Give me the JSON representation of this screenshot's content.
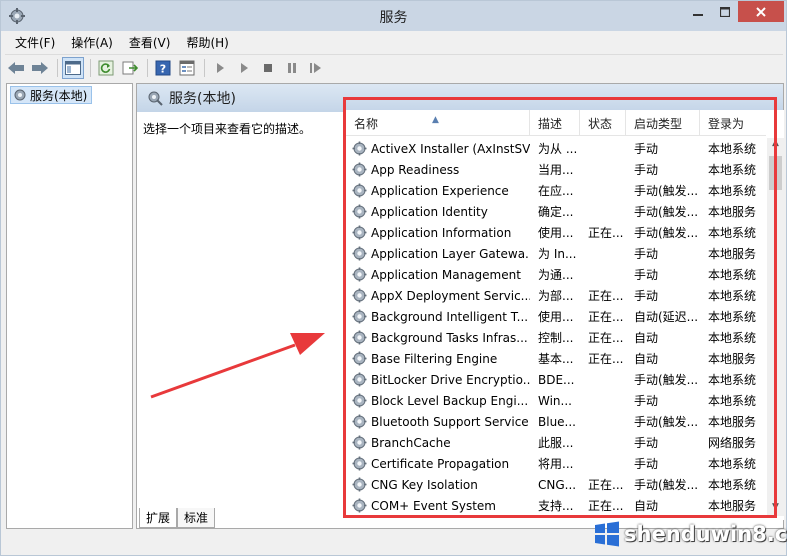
{
  "window": {
    "title": "服务"
  },
  "menu": [
    {
      "label": "文件(F)"
    },
    {
      "label": "操作(A)"
    },
    {
      "label": "查看(V)"
    },
    {
      "label": "帮助(H)"
    }
  ],
  "toolbar": {
    "icons": [
      "back-icon",
      "forward-icon",
      "show-tree-icon",
      "refresh-icon",
      "export-icon",
      "help-icon",
      "properties-icon",
      "start-icon",
      "start-alt-icon",
      "stop-icon",
      "pause-icon",
      "restart-icon"
    ]
  },
  "tree": {
    "item_label": "服务(本地)"
  },
  "main": {
    "header_title": "服务(本地)",
    "description_prompt": "选择一个项目来查看它的描述。"
  },
  "columns": {
    "name": "名称",
    "desc": "描述",
    "status": "状态",
    "start": "启动类型",
    "logon": "登录为"
  },
  "services": [
    {
      "name": "ActiveX Installer (AxInstSV)",
      "desc": "为从 ...",
      "status": "",
      "start": "手动",
      "logon": "本地系统"
    },
    {
      "name": "App Readiness",
      "desc": "当用...",
      "status": "",
      "start": "手动",
      "logon": "本地系统"
    },
    {
      "name": "Application Experience",
      "desc": "在应...",
      "status": "",
      "start": "手动(触发...",
      "logon": "本地系统"
    },
    {
      "name": "Application Identity",
      "desc": "确定...",
      "status": "",
      "start": "手动(触发...",
      "logon": "本地服务"
    },
    {
      "name": "Application Information",
      "desc": "使用...",
      "status": "正在...",
      "start": "手动(触发...",
      "logon": "本地系统"
    },
    {
      "name": "Application Layer Gatewa...",
      "desc": "为 In...",
      "status": "",
      "start": "手动",
      "logon": "本地服务"
    },
    {
      "name": "Application Management",
      "desc": "为通...",
      "status": "",
      "start": "手动",
      "logon": "本地系统"
    },
    {
      "name": "AppX Deployment Servic...",
      "desc": "为部...",
      "status": "正在...",
      "start": "手动",
      "logon": "本地系统"
    },
    {
      "name": "Background Intelligent T...",
      "desc": "使用...",
      "status": "正在...",
      "start": "自动(延迟...",
      "logon": "本地系统"
    },
    {
      "name": "Background Tasks Infras...",
      "desc": "控制...",
      "status": "正在...",
      "start": "自动",
      "logon": "本地系统"
    },
    {
      "name": "Base Filtering Engine",
      "desc": "基本...",
      "status": "正在...",
      "start": "自动",
      "logon": "本地服务"
    },
    {
      "name": "BitLocker Drive Encryptio...",
      "desc": "BDE...",
      "status": "",
      "start": "手动(触发...",
      "logon": "本地系统"
    },
    {
      "name": "Block Level Backup Engi...",
      "desc": "Win...",
      "status": "",
      "start": "手动",
      "logon": "本地系统"
    },
    {
      "name": "Bluetooth Support Service",
      "desc": "Blue...",
      "status": "",
      "start": "手动(触发...",
      "logon": "本地服务"
    },
    {
      "name": "BranchCache",
      "desc": "此服...",
      "status": "",
      "start": "手动",
      "logon": "网络服务"
    },
    {
      "name": "Certificate Propagation",
      "desc": "将用...",
      "status": "",
      "start": "手动",
      "logon": "本地系统"
    },
    {
      "name": "CNG Key Isolation",
      "desc": "CNG...",
      "status": "正在...",
      "start": "手动(触发...",
      "logon": "本地系统"
    },
    {
      "name": "COM+ Event System",
      "desc": "支持...",
      "status": "正在...",
      "start": "自动",
      "logon": "本地服务"
    }
  ],
  "tabs": [
    {
      "label": "扩展"
    },
    {
      "label": "标准"
    }
  ],
  "watermark": {
    "text": "shenduwin8.com"
  },
  "colors": {
    "highlight_box": "#e8393b",
    "arrow": "#e8393b",
    "title_bar": "#cad6e4",
    "close_button": "#c7504b"
  }
}
